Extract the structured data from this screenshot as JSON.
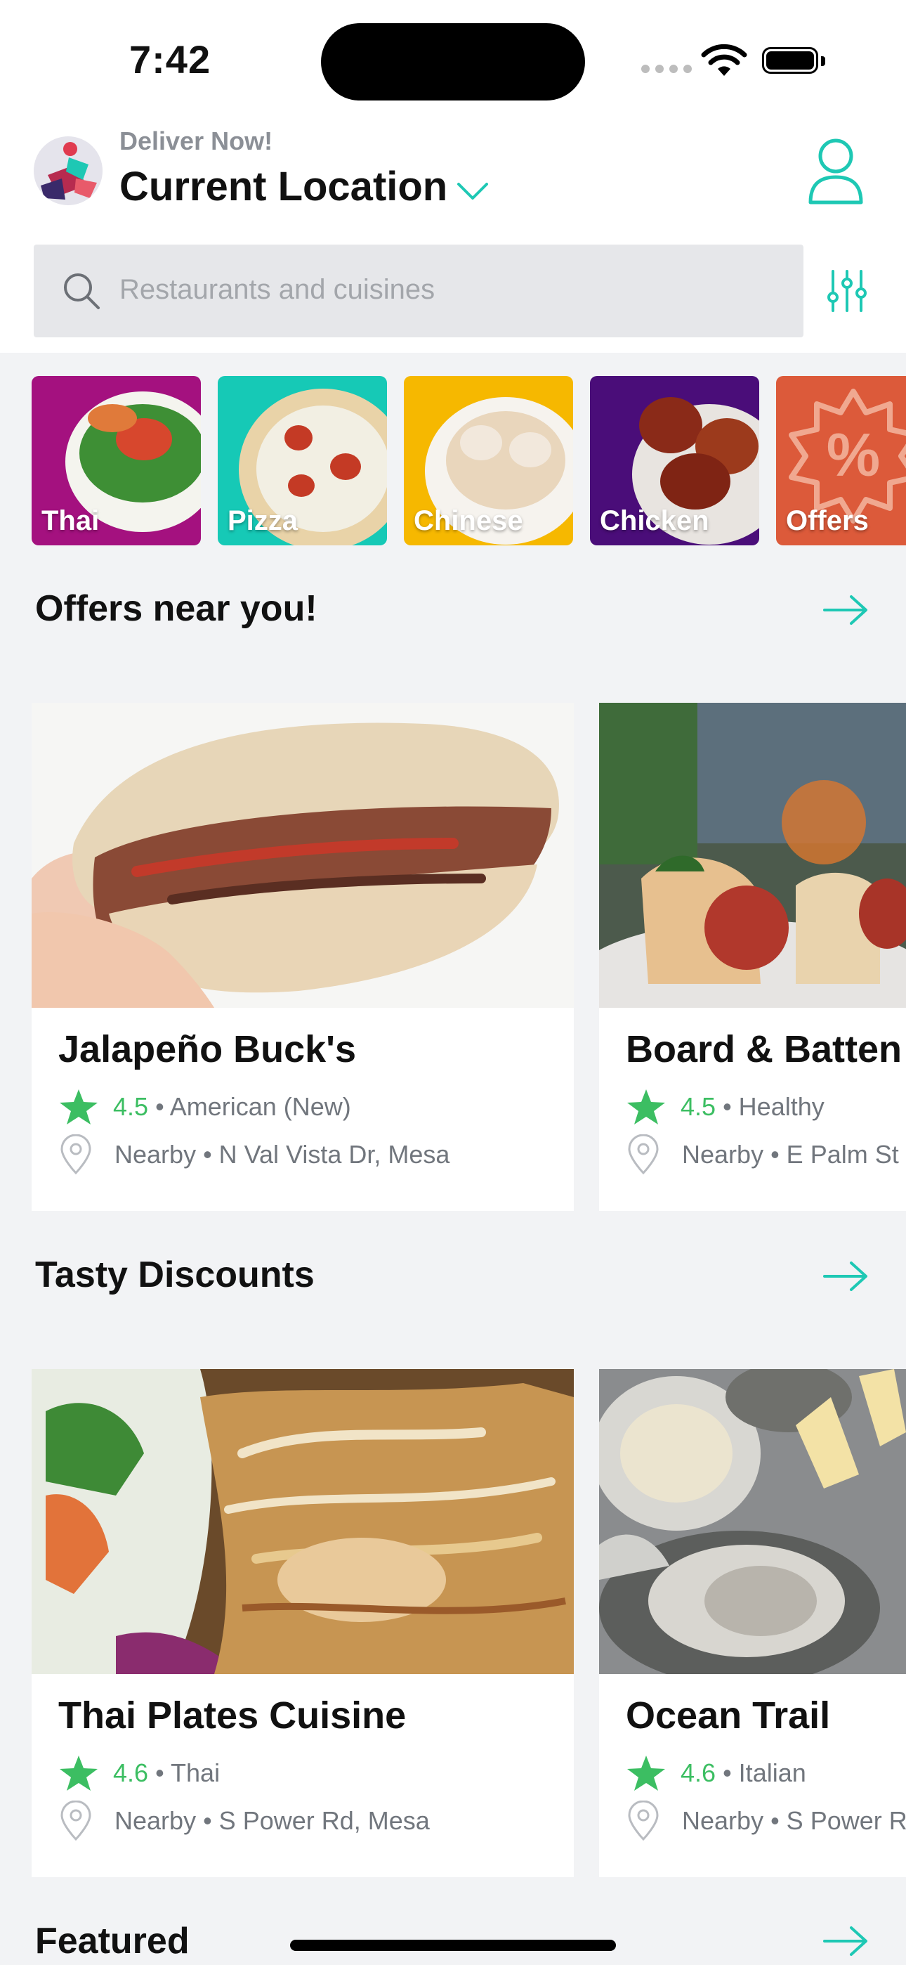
{
  "status": {
    "time": "7:42"
  },
  "header": {
    "deliver_label": "Deliver Now!",
    "location": "Current Location"
  },
  "search": {
    "placeholder": "Restaurants and cuisines"
  },
  "categories": [
    {
      "label": "Thai",
      "color": "#a4117f"
    },
    {
      "label": "Pizza",
      "color": "#16c9b6"
    },
    {
      "label": "Chinese",
      "color": "#f6b800"
    },
    {
      "label": "Chicken",
      "color": "#4a0d79"
    },
    {
      "label": "Offers",
      "color": "#dc5a3a"
    }
  ],
  "sections": {
    "offers": {
      "title": "Offers near you!",
      "cards": [
        {
          "name": "Jalapeño Buck's",
          "rating": "4.5",
          "cuisine": "• American (New)",
          "address": "Nearby • N Val Vista Dr, Mesa"
        },
        {
          "name": "Board & Batten",
          "rating": "4.5",
          "cuisine": "• Healthy",
          "address": "Nearby • E Palm St"
        }
      ]
    },
    "discounts": {
      "title": "Tasty Discounts",
      "cards": [
        {
          "name": "Thai Plates Cuisine",
          "rating": "4.6",
          "cuisine": "• Thai",
          "address": "Nearby • S Power Rd, Mesa"
        },
        {
          "name": "Ocean Trail",
          "rating": "4.6",
          "cuisine": "• Italian",
          "address": "Nearby • S Power R"
        }
      ]
    },
    "featured": {
      "title": "Featured"
    }
  },
  "colors": {
    "accent": "#1ec8b4",
    "rating_green": "#3cbe62",
    "muted": "#71767d"
  },
  "icons": [
    "search-icon",
    "filter-icon",
    "profile-icon",
    "chevron-down-icon",
    "arrow-right-icon",
    "star-icon",
    "location-pin-icon"
  ]
}
